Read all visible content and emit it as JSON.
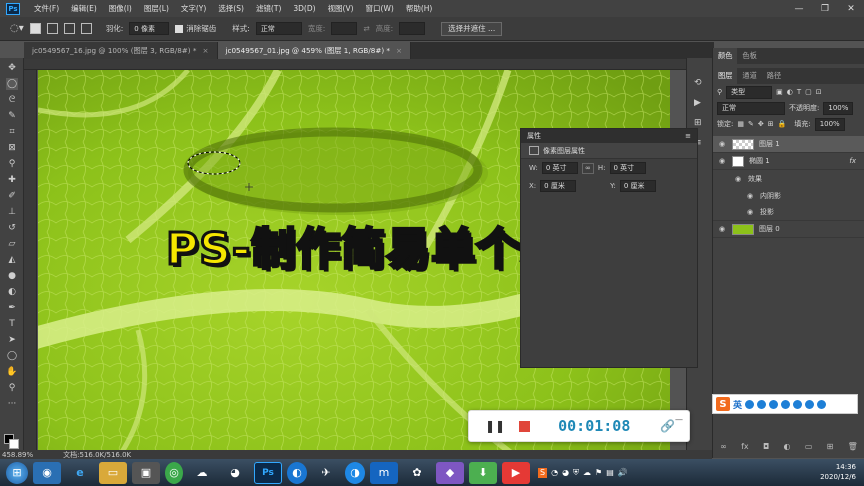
{
  "menubar": {
    "logo": "Ps",
    "items": [
      "文件(F)",
      "编辑(E)",
      "图像(I)",
      "图层(L)",
      "文字(Y)",
      "选择(S)",
      "滤镜(T)",
      "3D(D)",
      "视图(V)",
      "窗口(W)",
      "帮助(H)"
    ]
  },
  "window_controls": {
    "minimize": "—",
    "restore": "❐",
    "close": "✕"
  },
  "options": {
    "feather_label": "羽化:",
    "feather_value": "0 像素",
    "antialias_label": "消除锯齿",
    "style_label": "样式:",
    "style_value": "正常",
    "width_label": "宽度:",
    "height_label": "高度:",
    "select_mask_button": "选择并遮住 ..."
  },
  "tabs": [
    {
      "label": "jc0549567_16.jpg @ 100% (图层 3, RGB/8#) *",
      "close": "×"
    },
    {
      "label": "jc0549567_01.jpg @ 459% (图层 1, RGB/8#) *",
      "close": "×"
    }
  ],
  "properties": {
    "title": "属性",
    "subtitle": "像素图层属性",
    "w_label": "W:",
    "w_value": "0 英寸",
    "h_label": "H:",
    "h_value": "0 英寸",
    "x_label": "X:",
    "x_value": "0 厘米",
    "y_label": "Y:",
    "y_value": "0 厘米"
  },
  "right_panel": {
    "top_tabs": [
      "颜色",
      "色板"
    ],
    "layer_tabs": [
      "图层",
      "通道",
      "路径"
    ],
    "kind_label": "类型",
    "blend_mode": "正常",
    "opacity_label": "不透明度:",
    "opacity_value": "100%",
    "lock_label": "锁定:",
    "fill_label": "填充:",
    "fill_value": "100%",
    "layers": [
      {
        "name": "图层 1",
        "selected": true
      },
      {
        "name": "椭圆 1",
        "fx": "fx",
        "selected": false
      },
      {
        "name": "效果",
        "indent": 1
      },
      {
        "name": "内阴影",
        "indent": 2
      },
      {
        "name": "投影",
        "indent": 2
      },
      {
        "name": "图层 0",
        "selected": false
      }
    ]
  },
  "status": {
    "zoom": "458.89%",
    "doc": "文档:516.0K/516.0K"
  },
  "title_overlay": "PS-制作简易单个水珠",
  "recorder": {
    "pause": "❚❚",
    "time": "00:01:08",
    "link": "🔗",
    "minimize": "—"
  },
  "ime": {
    "logo": "S",
    "mode": "英"
  },
  "clock": {
    "time": "14:36",
    "date": "2020/12/6"
  },
  "colors": {
    "leaf": "#8cc11a",
    "title_yellow": "#f6e600",
    "timer_blue": "#1e88b6",
    "stop_red": "#e0463a"
  }
}
